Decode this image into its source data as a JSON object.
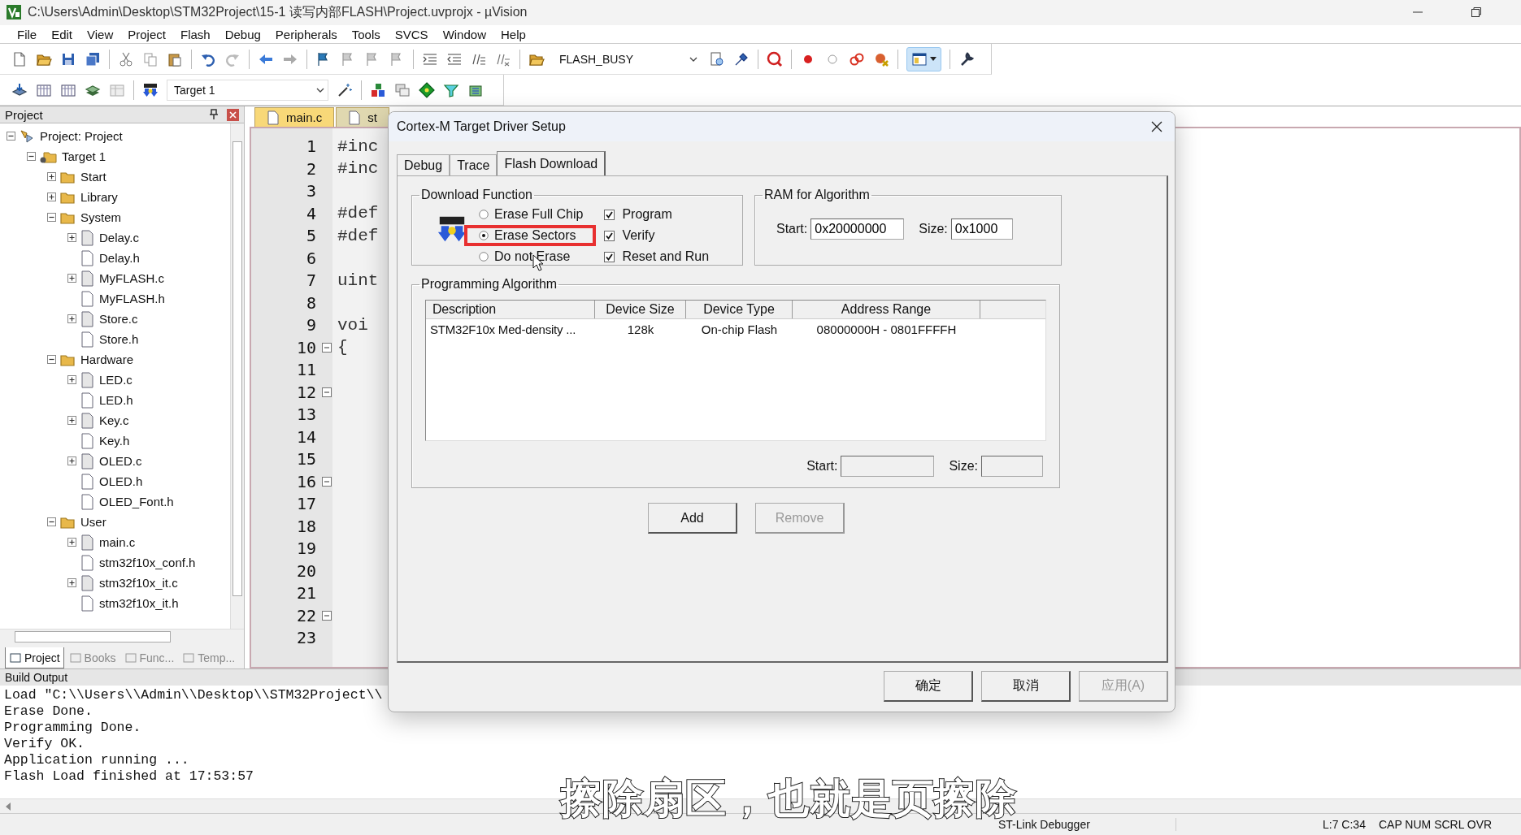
{
  "window": {
    "title": "C:\\Users\\Admin\\Desktop\\STM32Project\\15-1 读写内部FLASH\\Project.uvprojx - µVision"
  },
  "menu": [
    "File",
    "Edit",
    "View",
    "Project",
    "Flash",
    "Debug",
    "Peripherals",
    "Tools",
    "SVCS",
    "Window",
    "Help"
  ],
  "toolbar": {
    "find_dropdown": "FLASH_BUSY",
    "target_dropdown": "Target 1"
  },
  "project_panel": {
    "title": "Project",
    "tree": [
      {
        "label": "Project: Project",
        "kind": "project",
        "expanded": true,
        "children": [
          {
            "label": "Target 1",
            "kind": "target",
            "expanded": true,
            "children": [
              {
                "label": "Start",
                "kind": "group",
                "expanded": false
              },
              {
                "label": "Library",
                "kind": "group",
                "expanded": false
              },
              {
                "label": "System",
                "kind": "group",
                "expanded": true,
                "children": [
                  {
                    "label": "Delay.c",
                    "kind": "file",
                    "expanded": false
                  },
                  {
                    "label": "Delay.h",
                    "kind": "file"
                  },
                  {
                    "label": "MyFLASH.c",
                    "kind": "file",
                    "expanded": false
                  },
                  {
                    "label": "MyFLASH.h",
                    "kind": "file"
                  },
                  {
                    "label": "Store.c",
                    "kind": "file",
                    "expanded": false
                  },
                  {
                    "label": "Store.h",
                    "kind": "file"
                  }
                ]
              },
              {
                "label": "Hardware",
                "kind": "group",
                "expanded": true,
                "children": [
                  {
                    "label": "LED.c",
                    "kind": "file",
                    "expanded": false
                  },
                  {
                    "label": "LED.h",
                    "kind": "file"
                  },
                  {
                    "label": "Key.c",
                    "kind": "file",
                    "expanded": false
                  },
                  {
                    "label": "Key.h",
                    "kind": "file"
                  },
                  {
                    "label": "OLED.c",
                    "kind": "file",
                    "expanded": false
                  },
                  {
                    "label": "OLED.h",
                    "kind": "file"
                  },
                  {
                    "label": "OLED_Font.h",
                    "kind": "file"
                  }
                ]
              },
              {
                "label": "User",
                "kind": "group",
                "expanded": true,
                "children": [
                  {
                    "label": "main.c",
                    "kind": "file",
                    "expanded": false
                  },
                  {
                    "label": "stm32f10x_conf.h",
                    "kind": "file"
                  },
                  {
                    "label": "stm32f10x_it.c",
                    "kind": "file",
                    "expanded": false
                  },
                  {
                    "label": "stm32f10x_it.h",
                    "kind": "file"
                  }
                ]
              }
            ]
          }
        ]
      }
    ],
    "tabs": [
      {
        "label": "Project",
        "selected": true
      },
      {
        "label": "Books",
        "selected": false
      },
      {
        "label": "Func...",
        "selected": false
      },
      {
        "label": "Temp...",
        "selected": false
      }
    ]
  },
  "editor": {
    "tabs": [
      {
        "label": "main.c",
        "selected": true
      },
      {
        "label": "st",
        "selected": false
      }
    ],
    "lines": [
      {
        "number": "1",
        "code": "#inc",
        "fold": false
      },
      {
        "number": "2",
        "code": "#inc",
        "fold": false
      },
      {
        "number": "3",
        "fold": false
      },
      {
        "number": "4",
        "code": "#def",
        "fold": false
      },
      {
        "number": "5",
        "code": "#def",
        "fold": false
      },
      {
        "number": "6",
        "fold": false
      },
      {
        "number": "7",
        "code": "uint",
        "fold": false
      },
      {
        "number": "8",
        "fold": false
      },
      {
        "number": "9",
        "code": "voi",
        "fold": false
      },
      {
        "number": "10",
        "code": "{",
        "fold": true
      },
      {
        "number": "11",
        "fold": false
      },
      {
        "number": "12",
        "fold": true
      },
      {
        "number": "13",
        "fold": false
      },
      {
        "number": "14",
        "fold": false
      },
      {
        "number": "15",
        "fold": false
      },
      {
        "number": "16",
        "fold": true
      },
      {
        "number": "17",
        "fold": false
      },
      {
        "number": "18",
        "fold": false
      },
      {
        "number": "19",
        "fold": false
      },
      {
        "number": "20",
        "fold": false
      },
      {
        "number": "21",
        "fold": false
      },
      {
        "number": "22",
        "fold": true
      },
      {
        "number": "23",
        "fold": false
      }
    ]
  },
  "dialog": {
    "title": "Cortex-M Target Driver Setup",
    "tabs": [
      {
        "label": "Debug",
        "selected": false
      },
      {
        "label": "Trace",
        "selected": false
      },
      {
        "label": "Flash Download",
        "selected": true
      }
    ],
    "download_function": {
      "title": "Download Function",
      "erase_options": [
        {
          "label": "Erase Full Chip",
          "selected": false,
          "highlighted": false
        },
        {
          "label": "Erase Sectors",
          "selected": true,
          "highlighted": true
        },
        {
          "label": "Do not Erase",
          "selected": false,
          "highlighted": false
        }
      ],
      "options": [
        {
          "label": "Program",
          "checked": true
        },
        {
          "label": "Verify",
          "checked": true
        },
        {
          "label": "Reset and Run",
          "checked": true
        }
      ]
    },
    "ram": {
      "title": "RAM for Algorithm",
      "start_label": "Start:",
      "start": "0x20000000",
      "size_label": "Size:",
      "size": "0x1000"
    },
    "algorithm": {
      "title": "Programming Algorithm",
      "columns": [
        "Description",
        "Device Size",
        "Device Type",
        "Address Range"
      ],
      "rows": [
        [
          "STM32F10x Med-density ...",
          "128k",
          "On-chip Flash",
          "08000000H - 0801FFFFH"
        ]
      ],
      "start_label": "Start:",
      "size_label": "Size:"
    },
    "actions": [
      {
        "label": "Add",
        "disabled": false
      },
      {
        "label": "Remove",
        "disabled": true
      }
    ],
    "buttons": [
      {
        "label": "确定",
        "disabled": false
      },
      {
        "label": "取消",
        "disabled": false
      },
      {
        "label": "应用(A)",
        "disabled": true
      }
    ]
  },
  "build_output": {
    "title": "Build Output",
    "lines": [
      "Load \"C:\\\\Users\\\\Admin\\\\Desktop\\\\STM32Project\\\\",
      "Erase Done.",
      "Programming Done.",
      "Verify OK.",
      "Application running ...",
      "Flash Load finished at 17:53:57"
    ]
  },
  "status_bar": [
    "ST-Link Debugger",
    "L:7 C:34",
    "CAP NUM SCRL OVR"
  ],
  "subtitle": "擦除扇区，也就是页擦除"
}
